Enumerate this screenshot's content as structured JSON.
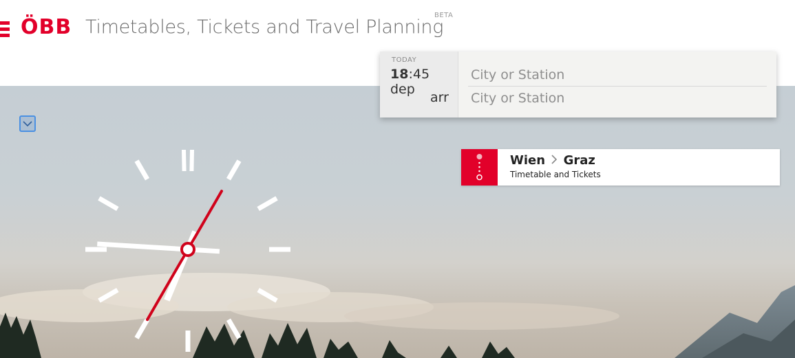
{
  "brand": {
    "logo_text": "ÖBB",
    "app_title": "Timetables, Tickets and Travel Planning",
    "beta_badge": "BETA",
    "brand_color": "#e2002a"
  },
  "search": {
    "day_label": "TODAY",
    "time_hours": "18",
    "time_minutes": ":45",
    "dep_label": "dep",
    "arr_label": "arr",
    "from_placeholder": "City or Station",
    "to_placeholder": "City or Station"
  },
  "clock": {
    "hour": 18,
    "minute": 45,
    "second": 35,
    "second_hand_color": "#d0021b"
  },
  "route": {
    "from": "Wien",
    "to": "Graz",
    "subtitle": "Timetable and Tickets"
  },
  "icons": [
    "chevron-down-icon",
    "route-dots-icon",
    "chevron-right-icon"
  ]
}
